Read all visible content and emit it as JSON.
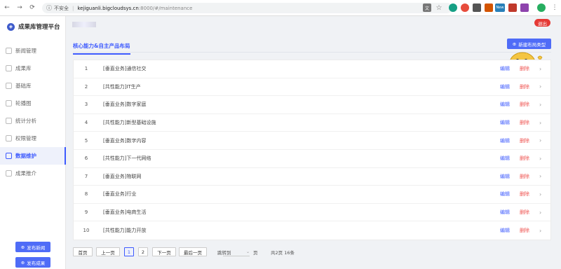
{
  "browser": {
    "security": "不安全",
    "host": "kejiguanli.bigcloudsys.cn",
    "path": ":8000/#/maintenance",
    "new_badge": "New"
  },
  "sidebar": {
    "brand": "成果库管理平台",
    "items": [
      {
        "label": "新闻管理"
      },
      {
        "label": "成果库"
      },
      {
        "label": "基础库"
      },
      {
        "label": "轮播图"
      },
      {
        "label": "统计分析"
      },
      {
        "label": "权限管理"
      },
      {
        "label": "数据维护"
      },
      {
        "label": "成果推介"
      }
    ],
    "publish_news": "发布新闻",
    "publish_result": "发布成果"
  },
  "header": {
    "logout": "退出"
  },
  "tab": {
    "label": "核心能力&自主产品布局"
  },
  "add_button": "新建布局类型",
  "table": {
    "edit_label": "编辑",
    "delete_label": "删除",
    "rows": [
      {
        "num": "1",
        "name": "[垂直业务]通信社交"
      },
      {
        "num": "2",
        "name": "[共性能力]IT生产"
      },
      {
        "num": "3",
        "name": "[垂直业务]数字家庭"
      },
      {
        "num": "4",
        "name": "[共性能力]新型基础设施"
      },
      {
        "num": "5",
        "name": "[垂直业务]数字内容"
      },
      {
        "num": "6",
        "name": "[共性能力]下一代网络"
      },
      {
        "num": "7",
        "name": "[垂直业务]物联网"
      },
      {
        "num": "8",
        "name": "[垂直业务]行业"
      },
      {
        "num": "9",
        "name": "[垂直业务]电商生活"
      },
      {
        "num": "10",
        "name": "[共性能力]能力开放"
      }
    ]
  },
  "pagination": {
    "first": "首页",
    "prev": "上一页",
    "page1": "1",
    "page2": "2",
    "next": "下一页",
    "last": "最后一页",
    "jump_to": "跳转到",
    "page_unit": "页",
    "summary": "共2页 16条"
  },
  "colors": {
    "accent": "#3d5afe",
    "danger": "#ef5350",
    "logout": "#e53935"
  }
}
